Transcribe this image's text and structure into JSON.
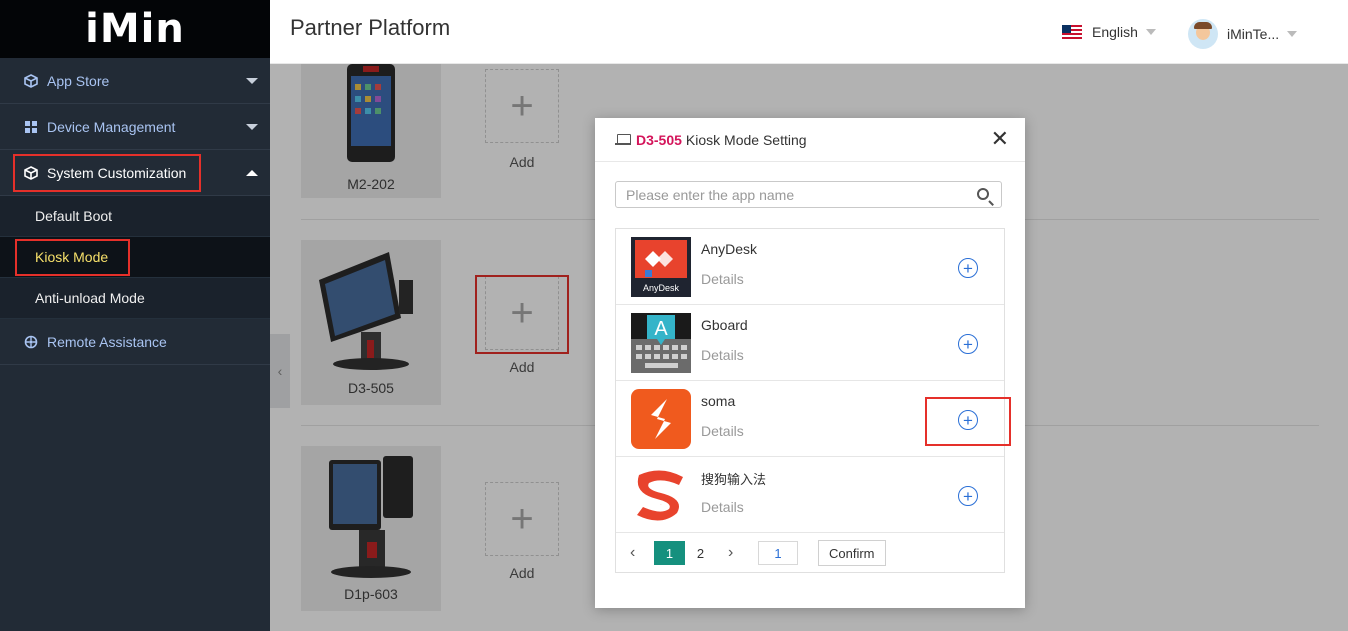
{
  "sidebar": {
    "logo": "iMin",
    "menu": [
      {
        "label": "App Store"
      },
      {
        "label": "Device Management"
      },
      {
        "label": "System Customization"
      }
    ],
    "submenu": [
      {
        "label": "Default Boot"
      },
      {
        "label": "Kiosk Mode"
      },
      {
        "label": "Anti-unload Mode"
      }
    ],
    "remote": {
      "label": "Remote Assistance"
    }
  },
  "header": {
    "title": "Partner Platform",
    "language": "English",
    "user": "iMinTe..."
  },
  "devices": [
    {
      "name": "M2-202",
      "add_label": "Add"
    },
    {
      "name": "D3-505",
      "add_label": "Add"
    },
    {
      "name": "D1p-603",
      "add_label": "Add"
    }
  ],
  "modal": {
    "model": "D3-505",
    "title": "Kiosk Mode Setting",
    "search_placeholder": "Please enter the app name",
    "apps": [
      {
        "name": "AnyDesk",
        "details": "Details",
        "icon_text": "AnyDesk"
      },
      {
        "name": "Gboard",
        "details": "Details",
        "icon_text": "A"
      },
      {
        "name": "soma",
        "details": "Details"
      },
      {
        "name": "搜狗输入法",
        "details": "Details",
        "icon_text": "S"
      }
    ],
    "pager": {
      "current": "1",
      "next_page": "2",
      "jump_value": "1",
      "confirm_label": "Confirm"
    }
  },
  "colors": {
    "sidebar_bg": "#222b36",
    "highlight_red": "#e5302a",
    "accent_teal": "#15907e",
    "link_blue": "#2a6fd6",
    "model_red": "#d4145a"
  }
}
